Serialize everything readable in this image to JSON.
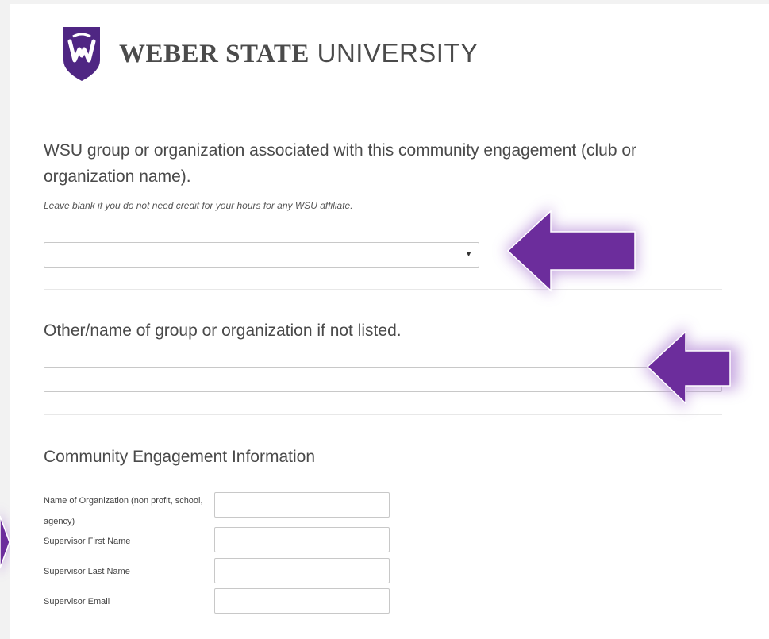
{
  "header": {
    "logo_icon": "wsu-shield-logo",
    "wordmark_bold": "WEBER STATE",
    "wordmark_light": "UNIVERSITY"
  },
  "question_group": {
    "label": "WSU group or organization associated with this community engagement (club or organization name).",
    "help_text": "Leave blank if you do not need credit for your hours for any WSU affiliate.",
    "selected_value": ""
  },
  "question_other": {
    "label": "Other/name of group or organization if not listed.",
    "value": ""
  },
  "community_section": {
    "title": "Community Engagement Information",
    "fields": [
      {
        "label": "Name of Organization  (non profit, school, agency)",
        "value": ""
      },
      {
        "label": "Supervisor First Name",
        "value": ""
      },
      {
        "label": "Supervisor Last Name",
        "value": ""
      },
      {
        "label": "Supervisor Email",
        "value": ""
      }
    ]
  },
  "colors": {
    "brand_purple": "#4f2683",
    "arrow_purple": "#6c2d9c",
    "arrow_glow": "#b48ad6"
  }
}
